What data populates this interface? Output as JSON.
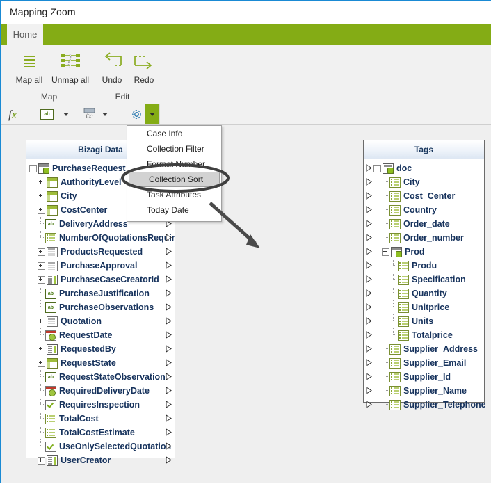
{
  "window": {
    "title": "Mapping Zoom"
  },
  "ribbon": {
    "tabs": [
      {
        "label": "Home",
        "active": true
      }
    ],
    "groups": [
      {
        "label": "Map",
        "buttons": [
          {
            "label": "Map all",
            "icon": "map-all-icon"
          },
          {
            "label": "Unmap all",
            "icon": "unmap-all-icon"
          }
        ]
      },
      {
        "label": "Edit",
        "buttons": [
          {
            "label": "Undo",
            "icon": "undo-icon"
          },
          {
            "label": "Redo",
            "icon": "redo-icon"
          }
        ]
      }
    ]
  },
  "formula_bar": {
    "items": [
      {
        "icon": "fx-icon",
        "has_caret": false
      },
      {
        "icon": "string-ab-icon",
        "has_caret": true
      },
      {
        "icon": "number-format-icon",
        "has_caret": true
      },
      {
        "icon": "gear-icon",
        "has_caret": true,
        "active": true
      }
    ]
  },
  "menu": {
    "open": true,
    "items": [
      {
        "label": "Case Info",
        "selected": false
      },
      {
        "label": "Collection Filter",
        "selected": false
      },
      {
        "label": "Format Number",
        "selected": false
      },
      {
        "label": "Collection Sort",
        "selected": true
      },
      {
        "label": "Task Attributes",
        "selected": false
      },
      {
        "label": "Today Date",
        "selected": false
      }
    ]
  },
  "annotation": {
    "highlight_target": "Collection Sort",
    "shape": "ellipse-with-arrow",
    "color": "#444444"
  },
  "panels": {
    "left": {
      "title": "Bizagi Data",
      "rows": [
        {
          "label": "PurchaseRequest",
          "icon": "entity-root-icon",
          "depth": 0,
          "expander": "minus",
          "connector": true
        },
        {
          "label": "AuthorityLevel",
          "icon": "table-icon",
          "depth": 1,
          "expander": "plus",
          "connector": true
        },
        {
          "label": "City",
          "icon": "table-icon",
          "depth": 1,
          "expander": "plus",
          "connector": true
        },
        {
          "label": "CostCenter",
          "icon": "table-icon",
          "depth": 1,
          "expander": "plus",
          "connector": true
        },
        {
          "label": "DeliveryAddress",
          "icon": "string-ab-icon",
          "depth": 1,
          "expander": "none",
          "connector": true
        },
        {
          "label": "NumberOfQuotationsRequir",
          "icon": "list-icon",
          "depth": 1,
          "expander": "none",
          "connector": true
        },
        {
          "label": "ProductsRequested",
          "icon": "collection-icon",
          "depth": 1,
          "expander": "plus",
          "connector": true
        },
        {
          "label": "PurchaseApproval",
          "icon": "collection-icon",
          "depth": 1,
          "expander": "plus",
          "connector": true
        },
        {
          "label": "PurchaseCaseCreatorId",
          "icon": "entity-icon",
          "depth": 1,
          "expander": "plus",
          "connector": true
        },
        {
          "label": "PurchaseJustification",
          "icon": "string-ab-icon",
          "depth": 1,
          "expander": "none",
          "connector": true
        },
        {
          "label": "PurchaseObservations",
          "icon": "string-ab-icon",
          "depth": 1,
          "expander": "none",
          "connector": true
        },
        {
          "label": "Quotation",
          "icon": "collection-icon",
          "depth": 1,
          "expander": "plus",
          "connector": true
        },
        {
          "label": "RequestDate",
          "icon": "date-icon",
          "depth": 1,
          "expander": "none",
          "connector": true
        },
        {
          "label": "RequestedBy",
          "icon": "entity-icon",
          "depth": 1,
          "expander": "plus",
          "connector": true
        },
        {
          "label": "RequestState",
          "icon": "table-icon",
          "depth": 1,
          "expander": "plus",
          "connector": true
        },
        {
          "label": "RequestStateObservation",
          "icon": "string-ab-icon",
          "depth": 1,
          "expander": "none",
          "connector": true
        },
        {
          "label": "RequiredDeliveryDate",
          "icon": "date-icon",
          "depth": 1,
          "expander": "none",
          "connector": true
        },
        {
          "label": "RequiresInspection",
          "icon": "checkbox-icon",
          "depth": 1,
          "expander": "none",
          "connector": true
        },
        {
          "label": "TotalCost",
          "icon": "list-icon",
          "depth": 1,
          "expander": "none",
          "connector": true
        },
        {
          "label": "TotalCostEstimate",
          "icon": "list-icon",
          "depth": 1,
          "expander": "none",
          "connector": true
        },
        {
          "label": "UseOnlySelectedQuotation",
          "icon": "checkbox-icon",
          "depth": 1,
          "expander": "none",
          "connector": true
        },
        {
          "label": "UserCreator",
          "icon": "entity-icon",
          "depth": 1,
          "expander": "plus",
          "connector": true
        }
      ]
    },
    "right": {
      "title": "Tags",
      "rows": [
        {
          "label": "doc",
          "icon": "xml-root-icon",
          "depth": 0,
          "expander": "minus",
          "connector": true
        },
        {
          "label": "City",
          "icon": "list-icon",
          "depth": 1,
          "expander": "none",
          "connector": true
        },
        {
          "label": "Cost_Center",
          "icon": "list-icon",
          "depth": 1,
          "expander": "none",
          "connector": true
        },
        {
          "label": "Country",
          "icon": "list-icon",
          "depth": 1,
          "expander": "none",
          "connector": true
        },
        {
          "label": "Order_date",
          "icon": "list-icon",
          "depth": 1,
          "expander": "none",
          "connector": true
        },
        {
          "label": "Order_number",
          "icon": "list-icon",
          "depth": 1,
          "expander": "none",
          "connector": true
        },
        {
          "label": "Prod",
          "icon": "xml-root-icon",
          "depth": 1,
          "expander": "minus",
          "connector": true
        },
        {
          "label": "Produ",
          "icon": "list-icon",
          "depth": 2,
          "expander": "none",
          "connector": true
        },
        {
          "label": "Specification",
          "icon": "list-icon",
          "depth": 2,
          "expander": "none",
          "connector": true
        },
        {
          "label": "Quantity",
          "icon": "list-icon",
          "depth": 2,
          "expander": "none",
          "connector": true
        },
        {
          "label": "Unitprice",
          "icon": "list-icon",
          "depth": 2,
          "expander": "none",
          "connector": true
        },
        {
          "label": "Units",
          "icon": "list-icon",
          "depth": 2,
          "expander": "none",
          "connector": true
        },
        {
          "label": "Totalprice",
          "icon": "list-icon",
          "depth": 2,
          "expander": "none",
          "connector": true
        },
        {
          "label": "Supplier_Address",
          "icon": "list-icon",
          "depth": 1,
          "expander": "none",
          "connector": true
        },
        {
          "label": "Supplier_Email",
          "icon": "list-icon",
          "depth": 1,
          "expander": "none",
          "connector": true
        },
        {
          "label": "Supplier_Id",
          "icon": "list-icon",
          "depth": 1,
          "expander": "none",
          "connector": true
        },
        {
          "label": "Supplier_Name",
          "icon": "list-icon",
          "depth": 1,
          "expander": "none",
          "connector": true
        },
        {
          "label": "Supplier_Telephone",
          "icon": "list-icon",
          "depth": 1,
          "expander": "none",
          "connector": true
        }
      ]
    }
  },
  "colors": {
    "accent_green": "#84ac15",
    "title_border_blue": "#1a8ad4",
    "canvas": "#efefef",
    "tree_text": "#16325c"
  }
}
